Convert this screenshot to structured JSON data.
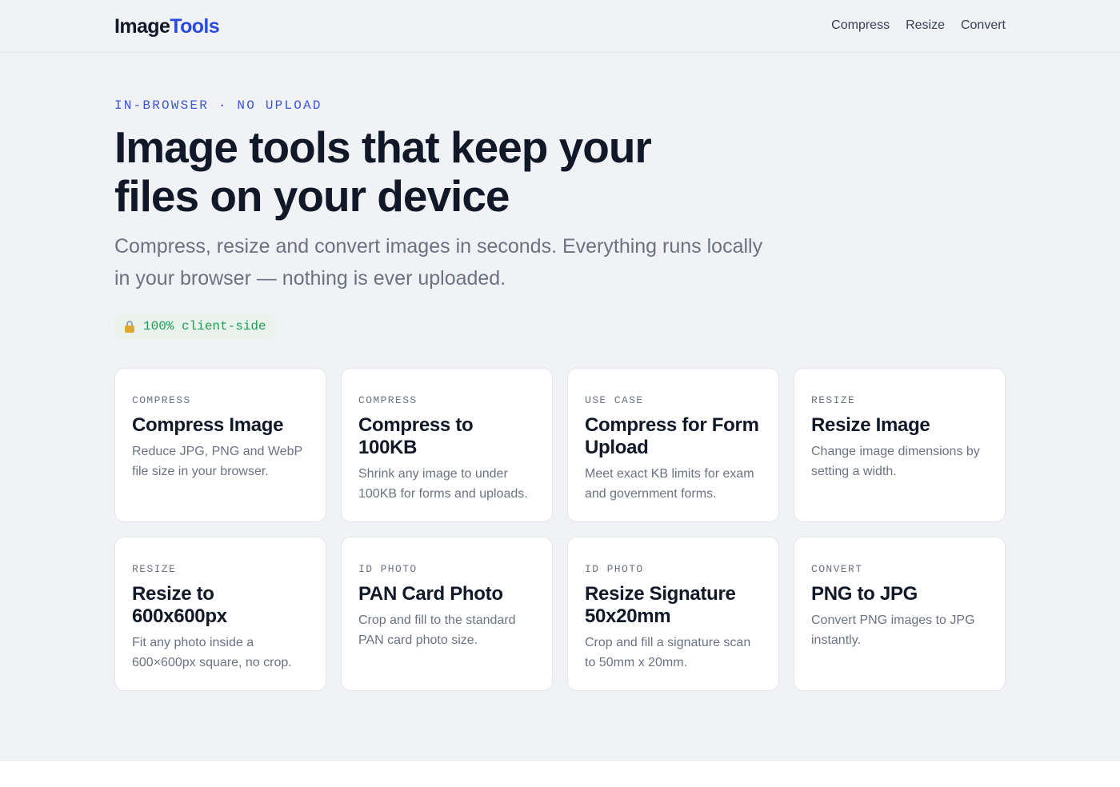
{
  "header": {
    "logo_main": "Image",
    "logo_accent": "Tools",
    "nav": [
      "Compress",
      "Resize",
      "Convert"
    ]
  },
  "hero": {
    "eyebrow": "IN-BROWSER · NO UPLOAD",
    "title": "Image tools that keep your files on your device",
    "subtitle": "Compress, resize and convert images in seconds. Everything runs locally in your browser — nothing is ever uploaded.",
    "badge": "100% client-side",
    "badge_icon": "lock-icon"
  },
  "colors": {
    "accent": "#2b4bdd",
    "badge_text": "#1f9d55",
    "badge_bg": "#eaf2ee",
    "page_bg": "#f1f2f6"
  },
  "cards": [
    {
      "tag": "COMPRESS",
      "title": "Compress Image",
      "desc": "Reduce JPG, PNG and WebP file size in your browser."
    },
    {
      "tag": "COMPRESS",
      "title": "Compress to 100KB",
      "desc": "Shrink any image to under 100KB for forms and uploads."
    },
    {
      "tag": "USE CASE",
      "title": "Compress for Form Upload",
      "desc": "Meet exact KB limits for exam and government forms."
    },
    {
      "tag": "RESIZE",
      "title": "Resize Image",
      "desc": "Change image dimensions by setting a width."
    },
    {
      "tag": "RESIZE",
      "title": "Resize to 600x600px",
      "desc": "Fit any photo inside a 600×600px square, no crop."
    },
    {
      "tag": "ID PHOTO",
      "title": "PAN Card Photo",
      "desc": "Crop and fill to the standard PAN card photo size."
    },
    {
      "tag": "ID PHOTO",
      "title": "Resize Signature 50x20mm",
      "desc": "Crop and fill a signature scan to 50mm x 20mm."
    },
    {
      "tag": "CONVERT",
      "title": "PNG to JPG",
      "desc": "Convert PNG images to JPG instantly."
    }
  ]
}
